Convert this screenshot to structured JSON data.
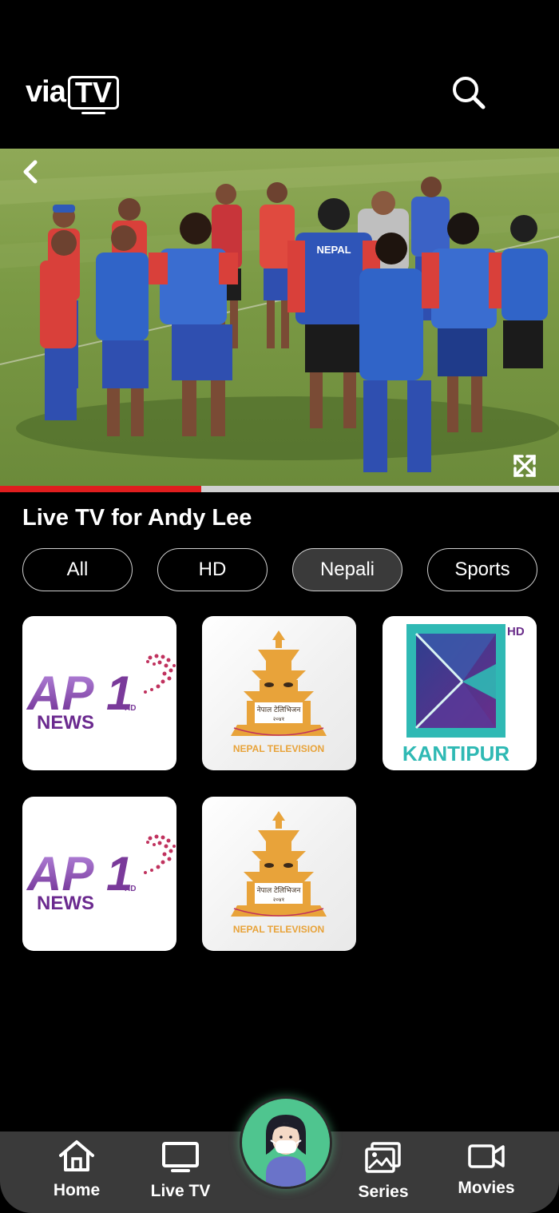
{
  "app": {
    "logo_via": "via",
    "logo_tv": "TV"
  },
  "header": {
    "search_icon": "search-icon"
  },
  "player": {
    "back_icon": "chevron-left-icon",
    "fullscreen_icon": "fullscreen-icon",
    "jersey_text": "NEPAL",
    "progress_fraction": 0.36,
    "progress_color": "#e01e1e"
  },
  "section": {
    "title": "Live TV for Andy Lee"
  },
  "filters": {
    "chips": [
      {
        "label": "All",
        "active": false
      },
      {
        "label": "HD",
        "active": false
      },
      {
        "label": "Nepali",
        "active": true
      },
      {
        "label": "Sports",
        "active": false
      }
    ]
  },
  "channels": [
    {
      "name": "AP1 HD News",
      "logo_main": "AP",
      "logo_num": "1",
      "logo_hd": "HD",
      "logo_sub": "NEWS"
    },
    {
      "name": "Nepal Television",
      "logo_nepali": "नेपाल टेलिभिजन",
      "logo_year": "२०४१",
      "logo_sub": "NEPAL TELEVISION"
    },
    {
      "name": "Kantipur HD",
      "logo_hd": "HD",
      "logo_sub": "KANTIPUR"
    },
    {
      "name": "AP1 HD News",
      "logo_main": "AP",
      "logo_num": "1",
      "logo_hd": "HD",
      "logo_sub": "NEWS"
    },
    {
      "name": "Nepal Television",
      "logo_nepali": "नेपाल टेलिभिजन",
      "logo_year": "२०४१",
      "logo_sub": "NEPAL TELEVISION"
    }
  ],
  "nav": {
    "items": [
      {
        "label": "Home",
        "icon": "home-icon"
      },
      {
        "label": "Live TV",
        "icon": "tv-icon"
      },
      {
        "label": "Series",
        "icon": "images-icon"
      },
      {
        "label": "Movies",
        "icon": "video-camera-icon"
      }
    ],
    "avatar_icon": "avatar-icon"
  },
  "colors": {
    "background": "#000000",
    "accent_green": "#4fc58f",
    "nav_background": "#3a3a3a",
    "ap1_purple": "#7a3a9a",
    "kantipur_teal": "#2fb9b4"
  }
}
